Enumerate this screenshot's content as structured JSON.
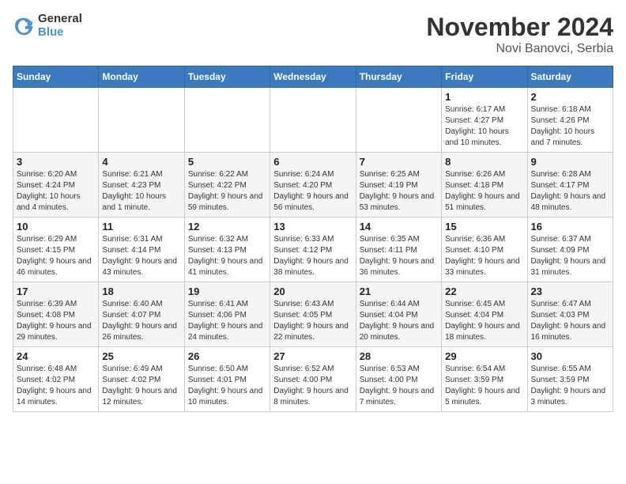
{
  "header": {
    "logo_general": "General",
    "logo_blue": "Blue",
    "month_title": "November 2024",
    "location": "Novi Banovci, Serbia"
  },
  "weekdays": [
    "Sunday",
    "Monday",
    "Tuesday",
    "Wednesday",
    "Thursday",
    "Friday",
    "Saturday"
  ],
  "weeks": [
    [
      {
        "day": "",
        "info": ""
      },
      {
        "day": "",
        "info": ""
      },
      {
        "day": "",
        "info": ""
      },
      {
        "day": "",
        "info": ""
      },
      {
        "day": "",
        "info": ""
      },
      {
        "day": "1",
        "info": "Sunrise: 6:17 AM\nSunset: 4:27 PM\nDaylight: 10 hours and 10 minutes."
      },
      {
        "day": "2",
        "info": "Sunrise: 6:18 AM\nSunset: 4:26 PM\nDaylight: 10 hours and 7 minutes."
      }
    ],
    [
      {
        "day": "3",
        "info": "Sunrise: 6:20 AM\nSunset: 4:24 PM\nDaylight: 10 hours and 4 minutes."
      },
      {
        "day": "4",
        "info": "Sunrise: 6:21 AM\nSunset: 4:23 PM\nDaylight: 10 hours and 1 minute."
      },
      {
        "day": "5",
        "info": "Sunrise: 6:22 AM\nSunset: 4:22 PM\nDaylight: 9 hours and 59 minutes."
      },
      {
        "day": "6",
        "info": "Sunrise: 6:24 AM\nSunset: 4:20 PM\nDaylight: 9 hours and 56 minutes."
      },
      {
        "day": "7",
        "info": "Sunrise: 6:25 AM\nSunset: 4:19 PM\nDaylight: 9 hours and 53 minutes."
      },
      {
        "day": "8",
        "info": "Sunrise: 6:26 AM\nSunset: 4:18 PM\nDaylight: 9 hours and 51 minutes."
      },
      {
        "day": "9",
        "info": "Sunrise: 6:28 AM\nSunset: 4:17 PM\nDaylight: 9 hours and 48 minutes."
      }
    ],
    [
      {
        "day": "10",
        "info": "Sunrise: 6:29 AM\nSunset: 4:15 PM\nDaylight: 9 hours and 46 minutes."
      },
      {
        "day": "11",
        "info": "Sunrise: 6:31 AM\nSunset: 4:14 PM\nDaylight: 9 hours and 43 minutes."
      },
      {
        "day": "12",
        "info": "Sunrise: 6:32 AM\nSunset: 4:13 PM\nDaylight: 9 hours and 41 minutes."
      },
      {
        "day": "13",
        "info": "Sunrise: 6:33 AM\nSunset: 4:12 PM\nDaylight: 9 hours and 38 minutes."
      },
      {
        "day": "14",
        "info": "Sunrise: 6:35 AM\nSunset: 4:11 PM\nDaylight: 9 hours and 36 minutes."
      },
      {
        "day": "15",
        "info": "Sunrise: 6:36 AM\nSunset: 4:10 PM\nDaylight: 9 hours and 33 minutes."
      },
      {
        "day": "16",
        "info": "Sunrise: 6:37 AM\nSunset: 4:09 PM\nDaylight: 9 hours and 31 minutes."
      }
    ],
    [
      {
        "day": "17",
        "info": "Sunrise: 6:39 AM\nSunset: 4:08 PM\nDaylight: 9 hours and 29 minutes."
      },
      {
        "day": "18",
        "info": "Sunrise: 6:40 AM\nSunset: 4:07 PM\nDaylight: 9 hours and 26 minutes."
      },
      {
        "day": "19",
        "info": "Sunrise: 6:41 AM\nSunset: 4:06 PM\nDaylight: 9 hours and 24 minutes."
      },
      {
        "day": "20",
        "info": "Sunrise: 6:43 AM\nSunset: 4:05 PM\nDaylight: 9 hours and 22 minutes."
      },
      {
        "day": "21",
        "info": "Sunrise: 6:44 AM\nSunset: 4:04 PM\nDaylight: 9 hours and 20 minutes."
      },
      {
        "day": "22",
        "info": "Sunrise: 6:45 AM\nSunset: 4:04 PM\nDaylight: 9 hours and 18 minutes."
      },
      {
        "day": "23",
        "info": "Sunrise: 6:47 AM\nSunset: 4:03 PM\nDaylight: 9 hours and 16 minutes."
      }
    ],
    [
      {
        "day": "24",
        "info": "Sunrise: 6:48 AM\nSunset: 4:02 PM\nDaylight: 9 hours and 14 minutes."
      },
      {
        "day": "25",
        "info": "Sunrise: 6:49 AM\nSunset: 4:02 PM\nDaylight: 9 hours and 12 minutes."
      },
      {
        "day": "26",
        "info": "Sunrise: 6:50 AM\nSunset: 4:01 PM\nDaylight: 9 hours and 10 minutes."
      },
      {
        "day": "27",
        "info": "Sunrise: 6:52 AM\nSunset: 4:00 PM\nDaylight: 9 hours and 8 minutes."
      },
      {
        "day": "28",
        "info": "Sunrise: 6:53 AM\nSunset: 4:00 PM\nDaylight: 9 hours and 7 minutes."
      },
      {
        "day": "29",
        "info": "Sunrise: 6:54 AM\nSunset: 3:59 PM\nDaylight: 9 hours and 5 minutes."
      },
      {
        "day": "30",
        "info": "Sunrise: 6:55 AM\nSunset: 3:59 PM\nDaylight: 9 hours and 3 minutes."
      }
    ]
  ]
}
